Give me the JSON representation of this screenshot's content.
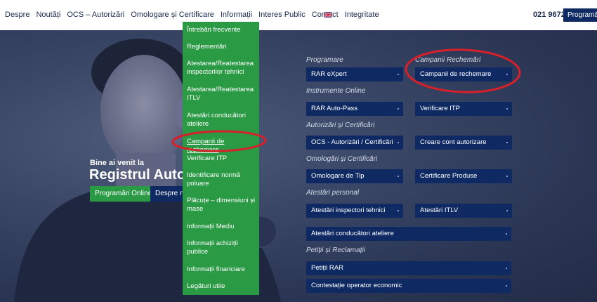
{
  "nav": {
    "items": [
      "Despre",
      "Noutăți",
      "OCS – Autorizări",
      "Omologare și Certificare",
      "Informații",
      "Interes Public",
      "Contact",
      "Integritate"
    ],
    "language_icon": "uk-flag-icon",
    "phone": "021 9672",
    "programari_label": "Programări"
  },
  "dropdown": {
    "items": [
      "Întrebări frecvente",
      "Reglementări",
      "Atestarea/Reatestarea inspectorilor tehnici",
      "Atestarea/Reatestarea ITLV",
      "Atestări conducători ateliere",
      "Campanii de rechemare",
      "Verificare ITP",
      "Identificare normă poluare",
      "Plăcuțe – dimensiuni și mase",
      "Informații Mediu",
      "Informații achiziții publice",
      "Informații financiare",
      "Legături utile"
    ],
    "highlighted_item": "Campanii de rechemare"
  },
  "hero": {
    "welcome": "Bine ai venit la",
    "title": "Registrul Auto",
    "btn_programari": "Programări Online",
    "btn_despre": "Despre noi"
  },
  "links": {
    "programare": {
      "label": "Programare",
      "buttons": [
        "RAR eXpert"
      ]
    },
    "campanii": {
      "label": "Campanii Rechemări",
      "buttons": [
        "Campanii de rechemare"
      ]
    },
    "instrumente": {
      "label": "Instrumente Online",
      "buttons": [
        "RAR Auto-Pass",
        "Verificare ITP"
      ]
    },
    "autorizari": {
      "label": "Autorizări și Certificări",
      "buttons": [
        "OCS - Autorizări / Certificări",
        "Creare cont autorizare"
      ]
    },
    "omologari": {
      "label": "Omologări și Certificări",
      "buttons": [
        "Omologare de Tip",
        "Certificare Produse"
      ]
    },
    "atestari": {
      "label": "Atestări personal",
      "buttons": [
        "Atestări inspectori tehnici",
        "Atestări ITLV",
        "Atestări conducători ateliere"
      ]
    },
    "petitii": {
      "label": "Petiții și Reclamații",
      "buttons": [
        "Petiții RAR",
        "Contestație operator economic"
      ]
    }
  },
  "colors": {
    "navy": "#0f2a63",
    "green": "#2b9a45",
    "annotation_red": "#d8202a"
  }
}
